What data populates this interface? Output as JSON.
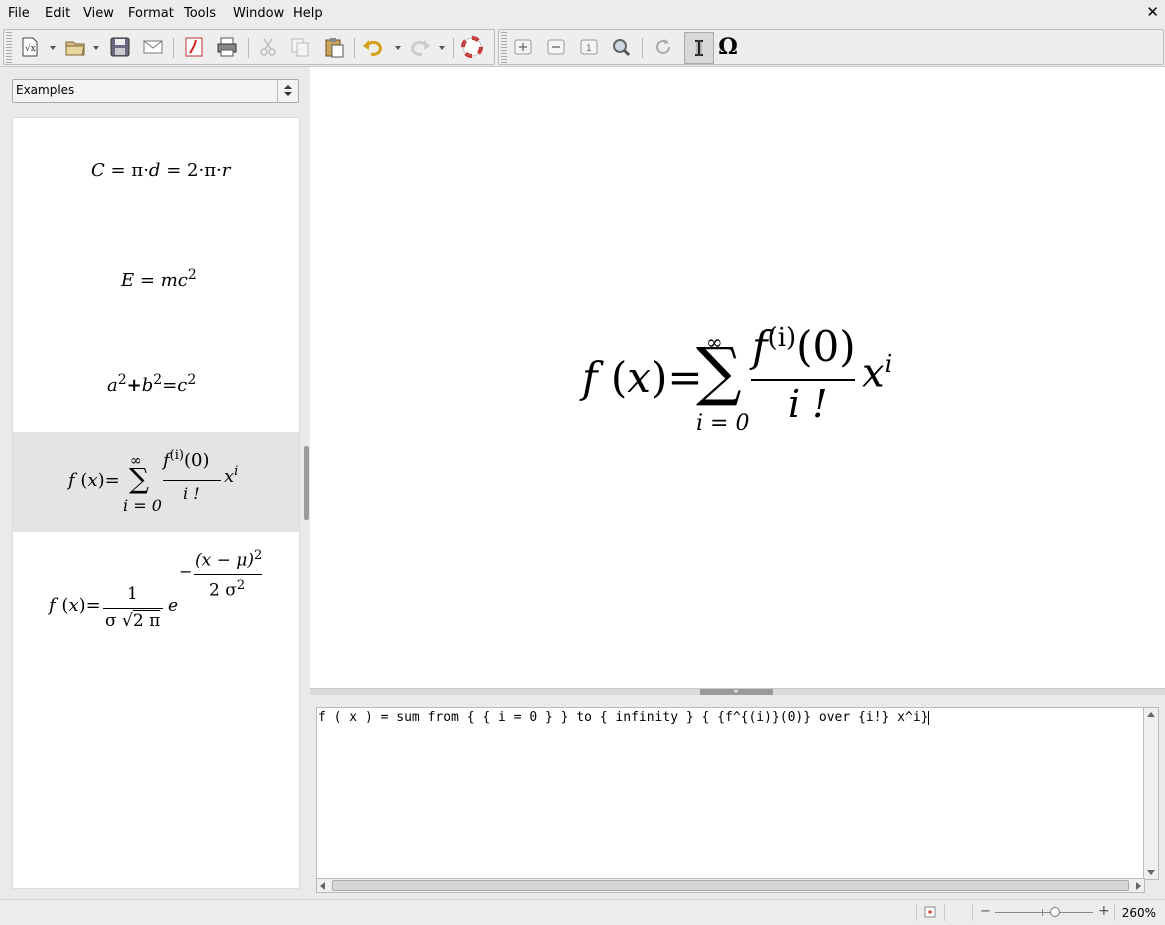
{
  "menu": {
    "items": [
      "File",
      "Edit",
      "View",
      "Format",
      "Tools",
      "Window",
      "Help"
    ],
    "close": "✕"
  },
  "toolbar": {
    "symbols_label": "Ω"
  },
  "sidebar": {
    "dropdown_value": "Examples",
    "examples": [
      {
        "id": "circle-circumference",
        "text": "C = π · d = 2 · π · r"
      },
      {
        "id": "mass-energy",
        "text": "E = mc²"
      },
      {
        "id": "pythagoras",
        "text": "a² + b² = c²"
      },
      {
        "id": "taylor-series",
        "text": "f(x) = Σ f^(i)(0)/i! x^i",
        "selected": true
      },
      {
        "id": "gaussian",
        "text": "f(x) = 1/(σ√2π) e^(−(x−μ)²/2σ²)"
      }
    ]
  },
  "preview": {
    "formula_text": "f(x) = Σ_{i=0}^{∞} f^(i)(0)/i! x^i"
  },
  "editor": {
    "content": "f ( x ) = sum from { { i = 0 } } to { infinity } { {f^{(i)}(0)} over {i!} x^i}"
  },
  "status": {
    "zoom": "260%"
  },
  "labels": {
    "ex1": {
      "C": "C",
      "eq1": "=",
      "pi1": "π",
      "d": "d",
      "eq2": "=",
      "two": "2",
      "pi2": "π",
      "r": "r"
    },
    "ex2": {
      "E": "E",
      "eq": "=",
      "mc": "mc",
      "exp": "2"
    },
    "ex3": {
      "a": "a",
      "a2": "2",
      "plus": "+",
      "b": "b",
      "b2": "2",
      "eq": "=",
      "c": "c",
      "c2": "2"
    },
    "taylor": {
      "f": "f",
      "lp": "(",
      "x": "x",
      "rp": ")",
      "eq": "=",
      "sigma": "∑",
      "inf": "∞",
      "lower": "i = 0",
      "num_f": "f",
      "num_sup": "(i)",
      "num_arg": "(0)",
      "den": "i !",
      "xi": "x",
      "xi_sup": "i"
    },
    "gauss": {
      "lhs": "f",
      "lp": "(",
      "x": "x",
      "rp": ")",
      "eq": "=",
      "one": "1",
      "sigma": "σ",
      "sqrt": "√",
      "twopi": "2 π",
      "e": "e",
      "minus": "−",
      "expnum": "(x − μ)",
      "expnum_sup": "2",
      "expden": "2 σ",
      "expden_sup": "2"
    }
  }
}
